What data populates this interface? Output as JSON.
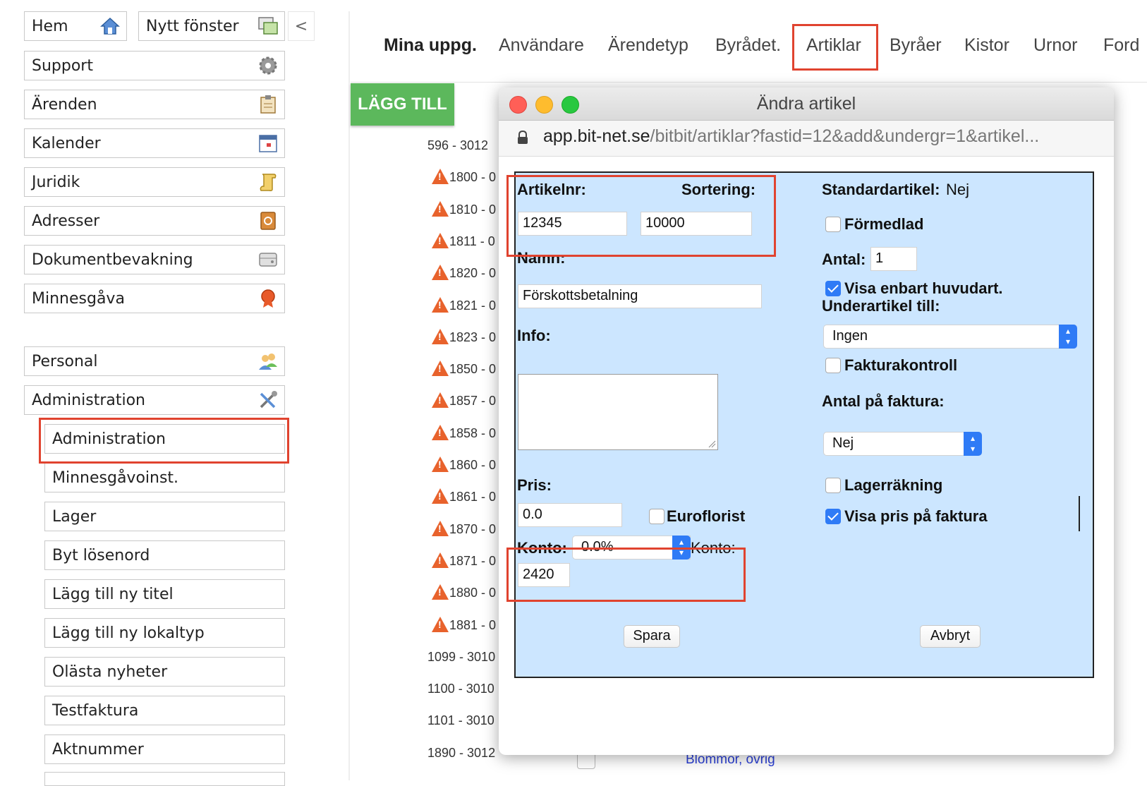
{
  "sidebar": {
    "top": [
      {
        "label": "Hem",
        "icon": "home-icon"
      },
      {
        "label": "Nytt fönster",
        "icon": "new-window-icon"
      },
      {
        "label": "<",
        "icon": "collapse-icon"
      }
    ],
    "items": [
      {
        "label": "Support",
        "icon": "gear-icon"
      },
      {
        "label": "Ärenden",
        "icon": "clipboard-icon"
      },
      {
        "label": "Kalender",
        "icon": "calendar-icon"
      },
      {
        "label": "Juridik",
        "icon": "scroll-icon"
      },
      {
        "label": "Adresser",
        "icon": "address-book-icon"
      },
      {
        "label": "Dokumentbevakning",
        "icon": "drive-icon"
      },
      {
        "label": "Minnesgåva",
        "icon": "award-icon"
      },
      {
        "label": "Personal",
        "icon": "people-icon"
      },
      {
        "label": "Administration",
        "icon": "tools-icon"
      }
    ],
    "subitems": [
      "Administration",
      "Minnesgåvoinst.",
      "Lager",
      "Byt lösenord",
      "Lägg till ny titel",
      "Lägg till ny lokaltyp",
      "Olästa nyheter",
      "Testfaktura",
      "Aktnummer"
    ]
  },
  "topnav": {
    "items": [
      "Mina uppg.",
      "Användare",
      "Ärendetyp",
      "Byrådet.",
      "Artiklar",
      "Byråer",
      "Kistor",
      "Urnor",
      "Ford"
    ],
    "active": "Artiklar"
  },
  "page": {
    "add_button": "LÄGG TILL",
    "rows": [
      {
        "label": "596 - 3012",
        "warn": false
      },
      {
        "label": "1800 - 0",
        "warn": true
      },
      {
        "label": "1810 - 0",
        "warn": true
      },
      {
        "label": "1811 - 0",
        "warn": true
      },
      {
        "label": "1820 - 0",
        "warn": true
      },
      {
        "label": "1821 - 0",
        "warn": true
      },
      {
        "label": "1823 - 0",
        "warn": true
      },
      {
        "label": "1850 - 0",
        "warn": true
      },
      {
        "label": "1857 - 0",
        "warn": true
      },
      {
        "label": "1858 - 0",
        "warn": true
      },
      {
        "label": "1860 - 0",
        "warn": true
      },
      {
        "label": "1861 - 0",
        "warn": true
      },
      {
        "label": "1870 - 0",
        "warn": true
      },
      {
        "label": "1871 - 0",
        "warn": true
      },
      {
        "label": "1880 - 0",
        "warn": true
      },
      {
        "label": "1881 - 0",
        "warn": true
      },
      {
        "label": "1099 - 3010",
        "warn": false
      },
      {
        "label": "1100 - 3010",
        "warn": false
      },
      {
        "label": "1101 - 3010",
        "warn": false
      },
      {
        "label": "1890 - 3012",
        "warn": false
      }
    ],
    "bottom_link": "Blommor, övrig"
  },
  "modal": {
    "title": "Ändra artikel",
    "url_domain": "app.bit-net.se",
    "url_path": "/bitbit/artiklar?fastid=12&add&undergr=1&artikel...",
    "form": {
      "artikelnr_label": "Artikelnr:",
      "artikelnr_value": "12345",
      "sortering_label": "Sortering:",
      "sortering_value": "10000",
      "namn_label": "Namn:",
      "namn_value": "Förskottsbetalning",
      "info_label": "Info:",
      "pris_label": "Pris:",
      "pris_value": "0.0",
      "euroflorist_label": "Euroflorist",
      "konto_label": "Konto:",
      "konto_select": "0.0%",
      "konto2_label": "Konto:",
      "konto_value": "2420",
      "standardartikel_label": "Standardartikel:",
      "standardartikel_value": "Nej",
      "formedlad_label": "Förmedlad",
      "antal_label": "Antal:",
      "antal_value": "1",
      "visa_huvudart_label": "Visa enbart huvudart.",
      "underartikel_label": "Underartikel till:",
      "underartikel_select": "Ingen",
      "fakturakontroll_label": "Fakturakontroll",
      "antal_faktura_label": "Antal på faktura:",
      "antal_faktura_select": "Nej",
      "lagerrakning_label": "Lagerräkning",
      "visa_pris_label": "Visa pris på faktura",
      "save_label": "Spara",
      "cancel_label": "Avbryt"
    },
    "checkboxes": {
      "formedlad": false,
      "visa_huvudart": true,
      "fakturakontroll": false,
      "lagerrakning": false,
      "visa_pris": true,
      "euroflorist": false
    }
  },
  "colors": {
    "highlight": "#e0432f",
    "add_button": "#5cb85c",
    "form_bg": "#cce6ff",
    "checkbox_on": "#2f7bf6",
    "warning": "#e8622c"
  }
}
